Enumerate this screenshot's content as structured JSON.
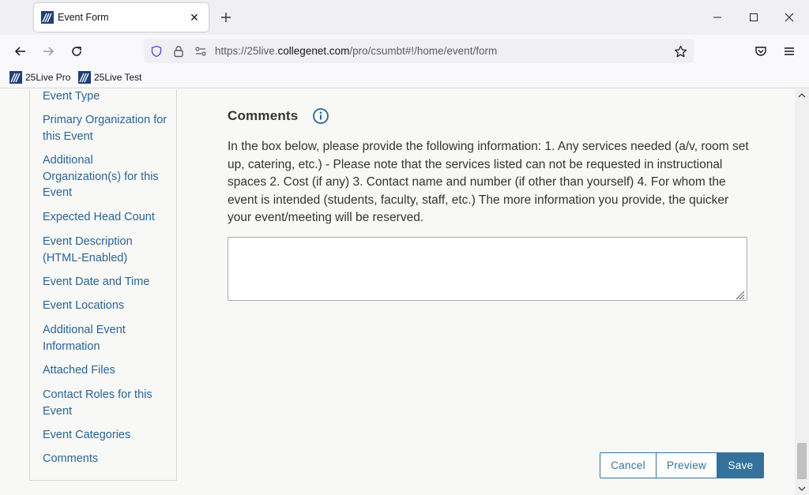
{
  "browser": {
    "tab_title": "Event Form",
    "url_prefix": "https://25live.",
    "url_domain": "collegenet.com",
    "url_path": "/pro/csumbt#!/home/event/form",
    "bookmarks": [
      "25Live Pro",
      "25Live Test"
    ]
  },
  "sidenav": {
    "items": [
      "Event Type",
      "Primary Organization for this Event",
      "Additional Organization(s) for this Event",
      "Expected Head Count",
      "Event Description (HTML-Enabled)",
      "Event Date and Time",
      "Event Locations",
      "Additional Event Information",
      "Attached Files",
      "Contact Roles for this Event",
      "Event Categories",
      "Comments"
    ]
  },
  "comments": {
    "title": "Comments",
    "instructions": "In the box below, please provide the following information: 1. Any services needed (a/v, room set up, catering, etc.) - Please note that the services listed can not be requested in instructional spaces 2. Cost (if any) 3. Contact name and number (if other than yourself) 4. For whom the event is intended (students, faculty, staff, etc.) The more information you provide, the quicker your event/meeting will be reserved.",
    "value": ""
  },
  "actions": {
    "cancel": "Cancel",
    "preview": "Preview",
    "save": "Save"
  },
  "colors": {
    "link": "#2a6496",
    "primary_button": "#34729c"
  }
}
